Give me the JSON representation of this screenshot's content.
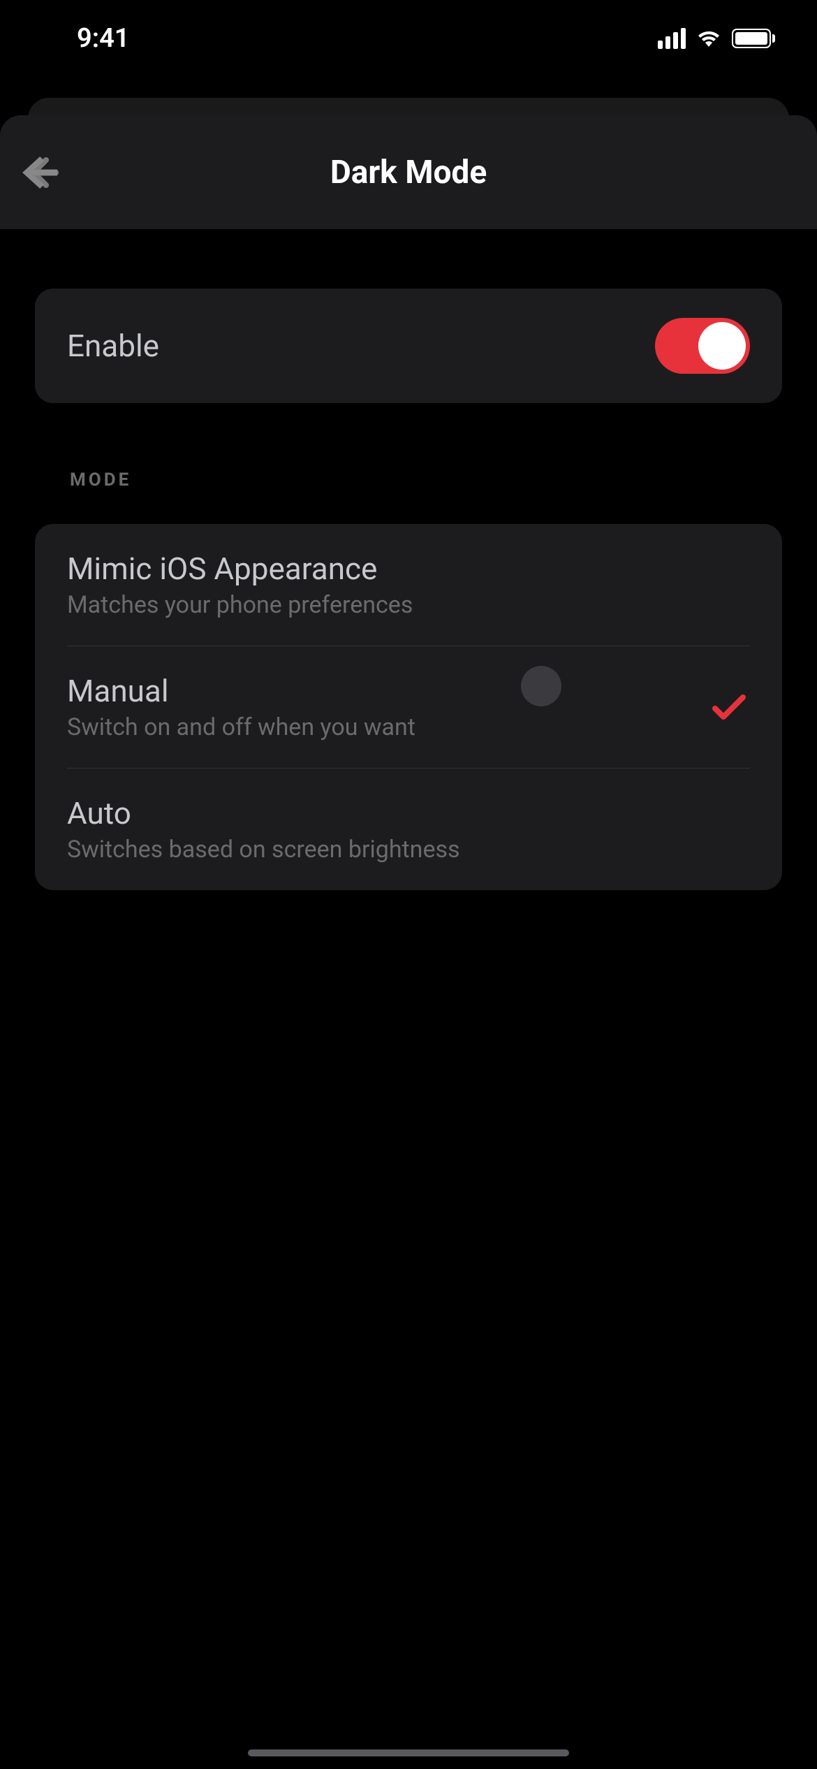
{
  "status": {
    "time": "9:41"
  },
  "header": {
    "title": "Dark Mode"
  },
  "enable": {
    "label": "Enable",
    "value": true
  },
  "section": {
    "mode_header": "MODE"
  },
  "modes": [
    {
      "title": "Mimic iOS Appearance",
      "subtitle": "Matches your phone preferences",
      "selected": false
    },
    {
      "title": "Manual",
      "subtitle": "Switch on and off when you want",
      "selected": true
    },
    {
      "title": "Auto",
      "subtitle": "Switches based on screen brightness",
      "selected": false
    }
  ],
  "colors": {
    "accent": "#e7323b",
    "card": "#1c1c1e",
    "bg": "#000000"
  }
}
